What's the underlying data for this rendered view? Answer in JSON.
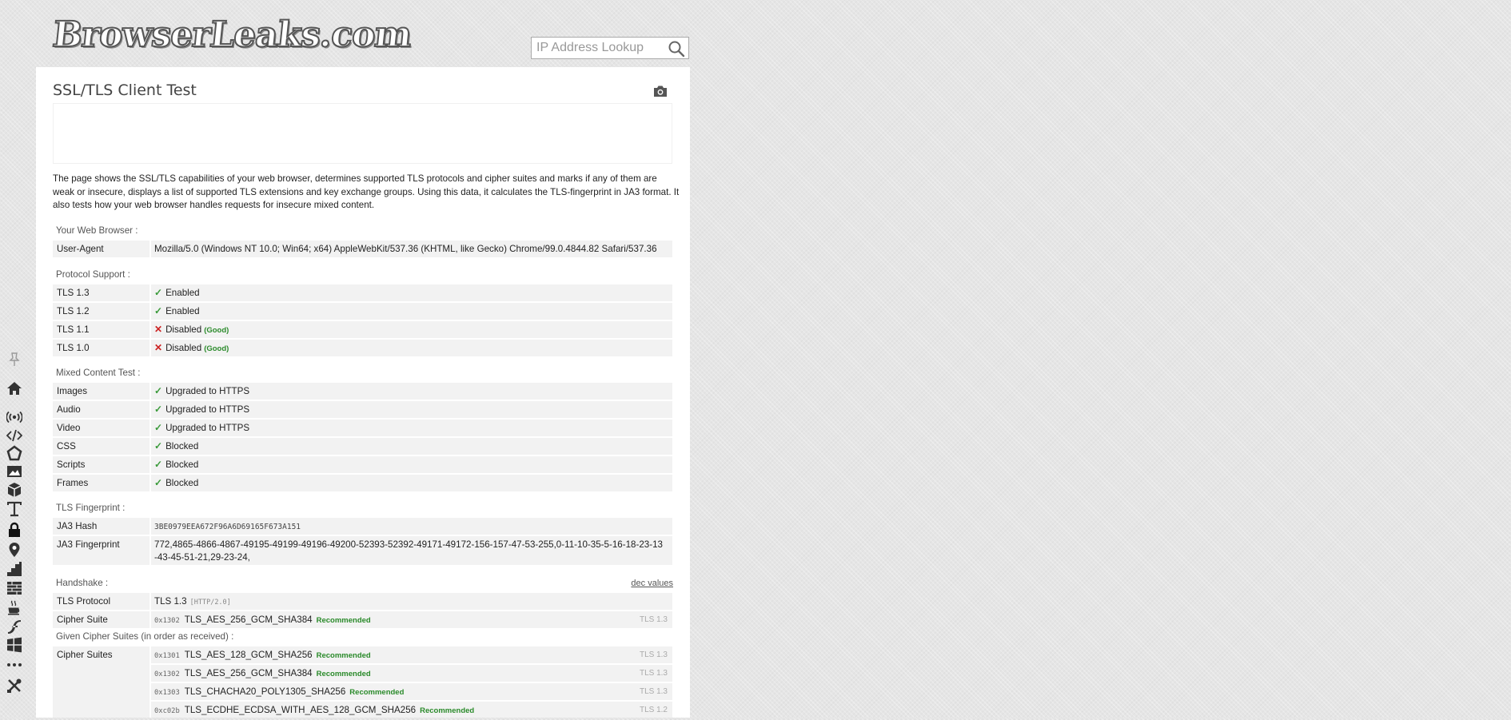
{
  "header": {
    "logo_text": "BrowserLeaks.com",
    "search_placeholder": "IP Address Lookup"
  },
  "page": {
    "title": "SSL/TLS Client Test",
    "description": "The page shows the SSL/TLS capabilities of your web browser, determines supported TLS protocols and cipher suites and marks if any of them are weak or insecure, displays a list of supported TLS extensions and key exchange groups. Using this data, it calculates the TLS-fingerprint in JA3 format. It also tests how your web browser handles requests for insecure mixed content."
  },
  "browser": {
    "label": "Your Web Browser :",
    "rows": [
      {
        "key": "User-Agent",
        "value": "Mozilla/5.0 (Windows NT 10.0; Win64; x64) AppleWebKit/537.36 (KHTML, like Gecko) Chrome/99.0.4844.82 Safari/537.36"
      }
    ]
  },
  "protocol": {
    "label": "Protocol Support :",
    "rows": [
      {
        "key": "TLS 1.3",
        "value": "Enabled",
        "note": ""
      },
      {
        "key": "TLS 1.2",
        "value": "Enabled",
        "note": ""
      },
      {
        "key": "TLS 1.1",
        "value": "Disabled",
        "note": "(Good)"
      },
      {
        "key": "TLS 1.0",
        "value": "Disabled",
        "note": "(Good)"
      }
    ]
  },
  "mixed": {
    "label": "Mixed Content Test :",
    "rows": [
      {
        "key": "Images",
        "value": "Upgraded to HTTPS"
      },
      {
        "key": "Audio",
        "value": "Upgraded to HTTPS"
      },
      {
        "key": "Video",
        "value": "Upgraded to HTTPS"
      },
      {
        "key": "CSS",
        "value": "Blocked"
      },
      {
        "key": "Scripts",
        "value": "Blocked"
      },
      {
        "key": "Frames",
        "value": "Blocked"
      }
    ]
  },
  "fingerprint": {
    "label": "TLS Fingerprint :",
    "ja3_hash_key": "JA3 Hash",
    "ja3_hash": "3BE0979EEA672F96A6D69165F673A151",
    "ja3_key": "JA3 Fingerprint",
    "ja3_line1": "772,4865-4866-4867-49195-49199-49196-49200-52393-52392-49171-49172-156-157-47-53-255,0-11-10-35-5-16-18-23-13",
    "ja3_line2": "-43-45-51-21,29-23-24,"
  },
  "handshake": {
    "label": "Handshake :",
    "dec_values": "dec values",
    "protocol_key": "TLS Protocol",
    "protocol_value": "TLS 1.3",
    "protocol_extra": "[HTTP/2.0]",
    "cipher_key": "Cipher Suite",
    "cipher_hex": "0x1302",
    "cipher_name": "TLS_AES_256_GCM_SHA384",
    "cipher_rec": "Recommended",
    "cipher_ver": "TLS 1.3"
  },
  "given": {
    "label": "Given Cipher Suites (in order as received) :",
    "key": "Cipher Suites",
    "rows": [
      {
        "hex": "0x1301",
        "name": "TLS_AES_128_GCM_SHA256",
        "rec": "Recommended",
        "ver": "TLS 1.3"
      },
      {
        "hex": "0x1302",
        "name": "TLS_AES_256_GCM_SHA384",
        "rec": "Recommended",
        "ver": "TLS 1.3"
      },
      {
        "hex": "0x1303",
        "name": "TLS_CHACHA20_POLY1305_SHA256",
        "rec": "Recommended",
        "ver": "TLS 1.3"
      },
      {
        "hex": "0xc02b",
        "name": "TLS_ECDHE_ECDSA_WITH_AES_128_GCM_SHA256",
        "rec": "Recommended",
        "ver": "TLS 1.2"
      }
    ]
  },
  "sidebar": {
    "items": [
      "pin-icon",
      "home-icon",
      "broadcast-icon",
      "code-icon",
      "webgl-icon",
      "image-icon",
      "cube-icon",
      "font-icon",
      "lock-icon",
      "location-icon",
      "chart-icon",
      "firewall-icon",
      "java-icon",
      "flash-icon",
      "windows-icon",
      "more-icon",
      "tools-icon"
    ]
  }
}
